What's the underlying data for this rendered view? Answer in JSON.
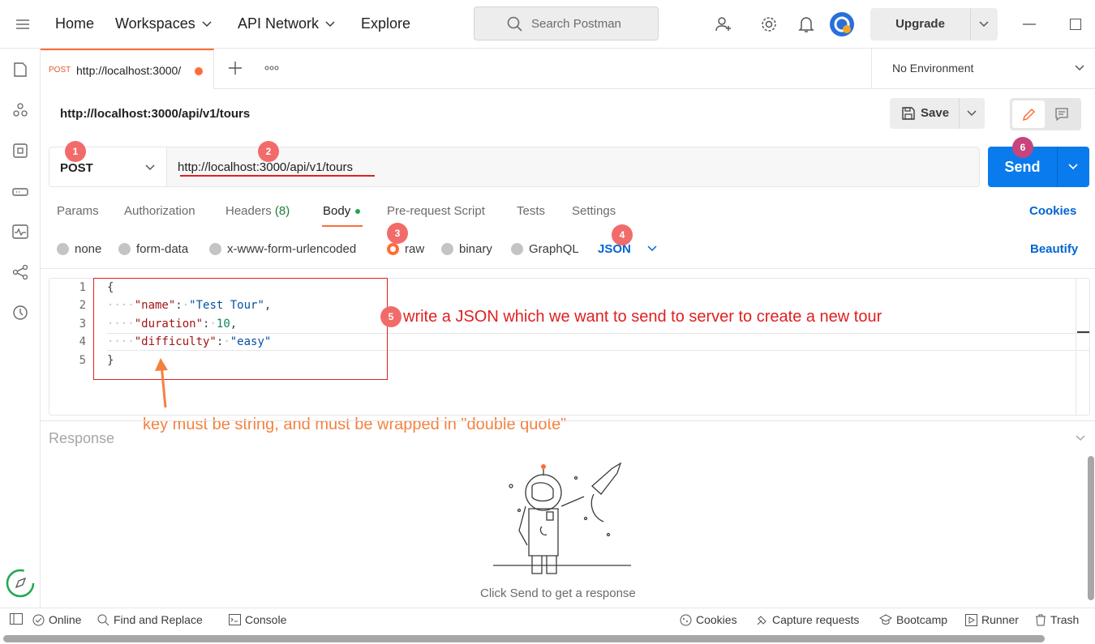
{
  "topbar": {
    "nav": [
      "Home",
      "Workspaces",
      "API Network",
      "Explore"
    ],
    "search_placeholder": "Search Postman",
    "upgrade_label": "Upgrade"
  },
  "tab": {
    "method": "POST",
    "url": "http://localhost:3000/"
  },
  "environment": "No Environment",
  "request": {
    "title": "http://localhost:3000/api/v1/tours",
    "save_label": "Save",
    "method": "POST",
    "url": "http://localhost:3000/api/v1/tours",
    "send_label": "Send"
  },
  "subtabs": {
    "params": "Params",
    "authorization": "Authorization",
    "headers": "Headers",
    "headers_count": "(8)",
    "body": "Body",
    "prerequest": "Pre-request Script",
    "tests": "Tests",
    "settings": "Settings",
    "cookies": "Cookies"
  },
  "body_types": {
    "none": "none",
    "form_data": "form-data",
    "urlencoded": "x-www-form-urlencoded",
    "raw": "raw",
    "binary": "binary",
    "graphql": "GraphQL",
    "format": "JSON",
    "beautify": "Beautify"
  },
  "editor": {
    "line_numbers": [
      "1",
      "2",
      "3",
      "4",
      "5"
    ],
    "open_brace": "{",
    "close_brace": "}",
    "lines": [
      {
        "key": "\"name\"",
        "value": "\"Test Tour\"",
        "comma": ","
      },
      {
        "key": "\"duration\"",
        "value": "10",
        "comma": ","
      },
      {
        "key": "\"difficulty\"",
        "value": "\"easy\"",
        "comma": ""
      }
    ]
  },
  "annotations": {
    "badges": [
      "1",
      "2",
      "3",
      "4",
      "5",
      "6"
    ],
    "note_json": "write a JSON which we want to send to server to create a new tour",
    "note_key": "key must be string, and must be wrapped in \"double quote\""
  },
  "response": {
    "label": "Response",
    "empty_text": "Click Send to get a response"
  },
  "statusbar": {
    "online": "Online",
    "find_replace": "Find and Replace",
    "console": "Console",
    "cookies": "Cookies",
    "capture": "Capture requests",
    "bootcamp": "Bootcamp",
    "runner": "Runner",
    "trash": "Trash"
  },
  "colors": {
    "accent": "#ff6c37",
    "send": "#097bed",
    "link": "#0265d2",
    "annotation_red": "#e02020",
    "annotation_orange": "#f5813f",
    "badge": "#f26b6b"
  }
}
